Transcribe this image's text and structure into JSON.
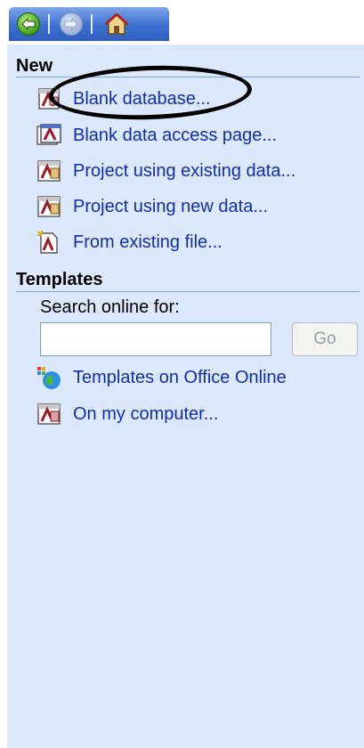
{
  "nav": {
    "back": "back-arrow-icon",
    "forward": "forward-arrow-icon",
    "home": "home-icon"
  },
  "sections": {
    "new": {
      "title": "New",
      "items": [
        {
          "label": "Blank database...",
          "icon": "access-database-icon"
        },
        {
          "label": "Blank data access page...",
          "icon": "access-page-icon"
        },
        {
          "label": "Project using existing data...",
          "icon": "access-project-icon"
        },
        {
          "label": "Project using new data...",
          "icon": "access-project-icon"
        },
        {
          "label": "From existing file...",
          "icon": "existing-file-icon"
        }
      ]
    },
    "templates": {
      "title": "Templates",
      "search_label": "Search online for:",
      "search_value": "",
      "go_label": "Go",
      "items": [
        {
          "label": "Templates on Office Online",
          "icon": "office-online-globe-icon"
        },
        {
          "label": "On my computer...",
          "icon": "access-template-icon"
        }
      ]
    }
  },
  "colors": {
    "pane_bg": "#dce8fb",
    "link": "#0f2fa8",
    "nav_blue": "#3b6fd0",
    "rule": "#7aa4e0"
  }
}
